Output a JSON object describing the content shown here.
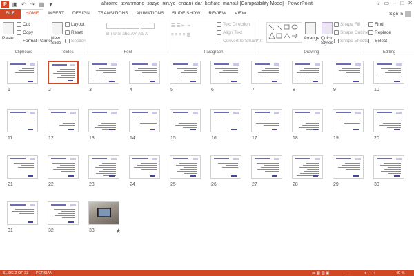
{
  "window": {
    "title": "ahrome_tavanmand_sazye_niruye_ensani_dar_keifiate_mahsul [Compatibility Mode] - PowerPoint",
    "app_icon": "P",
    "controls": [
      "?",
      "▭",
      "–",
      "□",
      "✕"
    ]
  },
  "tabs": [
    "FILE",
    "HOME",
    "INSERT",
    "DESIGN",
    "TRANSITIONS",
    "ANIMATIONS",
    "SLIDE SHOW",
    "REVIEW",
    "VIEW"
  ],
  "active_tab": "HOME",
  "account": {
    "sign_in": "Sign in"
  },
  "ribbon": {
    "clipboard": {
      "label": "Clipboard",
      "paste": "Paste",
      "cut": "Cut",
      "copy": "Copy",
      "format_painter": "Format Painter"
    },
    "slides": {
      "label": "Slides",
      "new_slide": "New",
      "new_slide_2": "Slide",
      "layout": "Layout",
      "reset": "Reset",
      "section": "Section"
    },
    "font": {
      "label": "Font"
    },
    "paragraph": {
      "label": "Paragraph",
      "text_direction": "Text Direction",
      "align_text": "Align Text",
      "convert_smartart": "Convert to SmartArt"
    },
    "drawing": {
      "label": "Drawing",
      "arrange": "Arrange",
      "quick_styles": "Quick",
      "quick_styles_2": "Styles",
      "shape_fill": "Shape Fill",
      "shape_outline": "Shape Outline",
      "shape_effects": "Shape Effects"
    },
    "editing": {
      "label": "Editing",
      "find": "Find",
      "replace": "Replace",
      "select": "Select"
    }
  },
  "slides": [
    "1",
    "2",
    "3",
    "4",
    "5",
    "6",
    "7",
    "8",
    "9",
    "10",
    "11",
    "12",
    "13",
    "14",
    "15",
    "16",
    "17",
    "18",
    "19",
    "20",
    "21",
    "22",
    "23",
    "24",
    "25",
    "26",
    "27",
    "28",
    "29",
    "30",
    "31",
    "32",
    "33"
  ],
  "selected_slide": "2",
  "last_slide_marker": "★",
  "status": {
    "slide_info": "SLIDE 2 OF 33",
    "language": "PERSIAN",
    "zoom": "40 %"
  },
  "colors": {
    "accent": "#d24726"
  }
}
